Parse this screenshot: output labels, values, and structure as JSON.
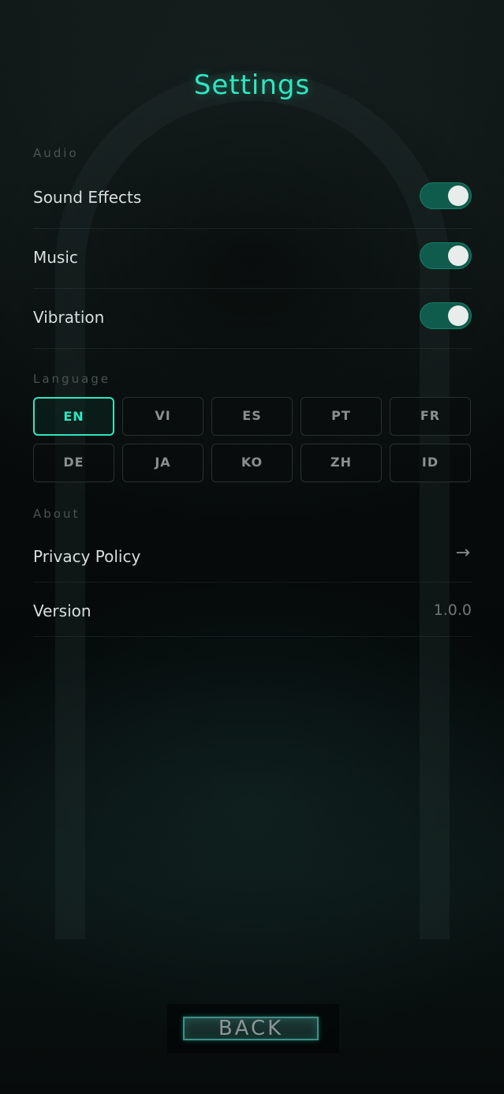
{
  "title": "Settings",
  "audio": {
    "section_label": "Audio",
    "rows": [
      {
        "label": "Sound Effects",
        "enabled": true
      },
      {
        "label": "Music",
        "enabled": true
      },
      {
        "label": "Vibration",
        "enabled": true
      }
    ]
  },
  "language": {
    "section_label": "Language",
    "selected": "EN",
    "options": [
      "EN",
      "VI",
      "ES",
      "PT",
      "FR",
      "DE",
      "JA",
      "KO",
      "ZH",
      "ID"
    ]
  },
  "about": {
    "section_label": "About",
    "privacy_label": "Privacy Policy",
    "privacy_arrow": "→",
    "version_label": "Version",
    "version_value": "1.0.0"
  },
  "back_label": "BACK",
  "colors": {
    "accent": "#2fe6bf",
    "toggle_on": "#0f5c4c"
  }
}
